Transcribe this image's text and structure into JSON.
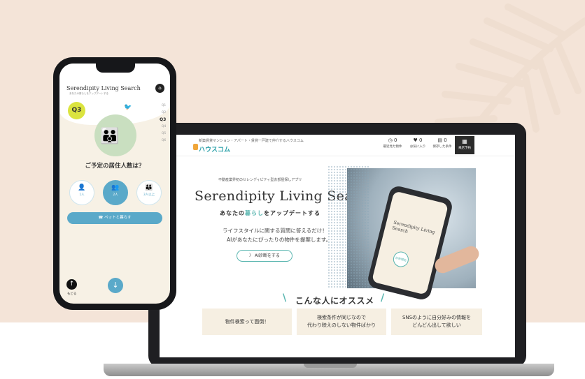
{
  "laptop": {
    "header": {
      "tagline": "新築賃貸マンション・アパート・賃貸一戸建て仲介するハウスコム",
      "logo": "ハウスコム",
      "nav": [
        {
          "icon": "history-icon",
          "count": "0",
          "label": "最近見た物件"
        },
        {
          "icon": "heart-icon",
          "count": "0",
          "label": "お気に入り"
        },
        {
          "icon": "saved-search-icon",
          "count": "0",
          "label": "保存した条件"
        }
      ],
      "nav_dark": {
        "icon": "calendar-icon",
        "label": "来店予約"
      }
    },
    "hero": {
      "subtitle": "不動産業界初のセレンディピティ型お部屋探しアプリ",
      "title": "Serendipity Living Search",
      "tagline_pre": "あなたの",
      "tagline_hl": "暮らし",
      "tagline_post": "をアップデートする",
      "desc_line1": "ライフスタイルに関する質問に答えるだけ！",
      "desc_line2": "AIがあなたにぴったりの物件を提案します。",
      "cta": "〉 AI診断をする",
      "phone_title": "Serendipity Living Search",
      "phone_button": "診断開始"
    },
    "recommend": {
      "title": "こんな人にオススメ",
      "cards": [
        "物件検索って面倒！",
        "検索条件が同じなので\n代わり映えのしない物件ばかり",
        "SNSのように自分好みの情報を\nどんどん出して欲しい"
      ]
    }
  },
  "phone": {
    "logo": "Serendipity Living Search",
    "logo_sub": "あなたの暮らしをアップデートする",
    "question_number": "Q3",
    "steps": [
      "Q1",
      "Q2",
      "Q3",
      "Q4",
      "Q5",
      "Q6"
    ],
    "current_step": "Q3",
    "question": "ご予定の居住人数は？",
    "options": [
      {
        "label": "1人",
        "selected": false
      },
      {
        "label": "2人",
        "selected": true
      },
      {
        "label": "3人以上",
        "selected": false
      }
    ],
    "pet_button": "ペットと暮らす",
    "back_label": "もどる"
  },
  "colors": {
    "background": "#f4e4d8",
    "accent_blue": "#5aa9c9",
    "accent_teal": "#5ab6b0",
    "question_badge": "#dbe43f"
  }
}
